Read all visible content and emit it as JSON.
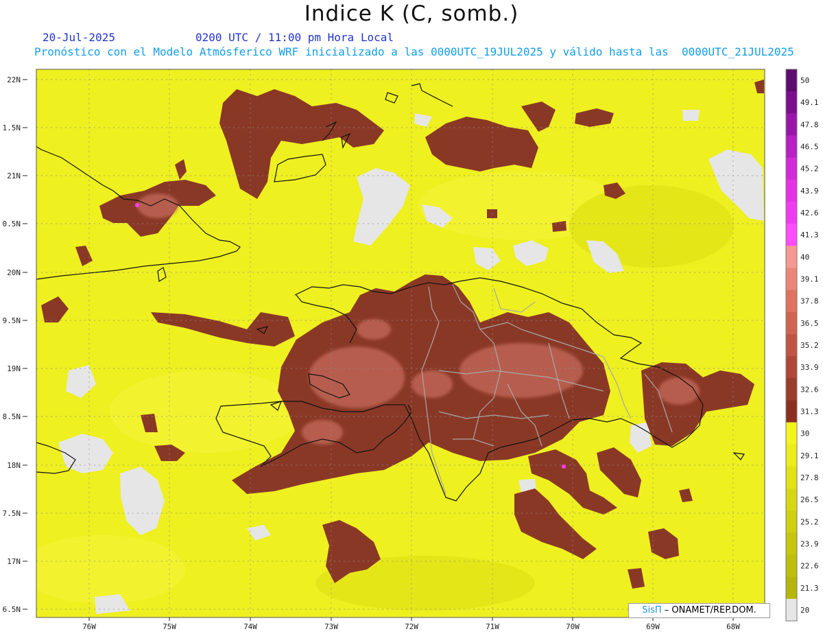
{
  "header": {
    "title": "Indice K (C, somb.)",
    "date": "20-Jul-2025",
    "time": "0200 UTC / 11:00 pm Hora Local",
    "description": "Pronóstico con el Modelo Atmósferico WRF inicializado a las 0000UTC_19JUL2025 y válido hasta las  0000UTC_21JUL2025"
  },
  "map": {
    "lat_labels": [
      "22N",
      "1.5N",
      "21N",
      "0.5N",
      "20N",
      "9.5N",
      "19N",
      "8.5N",
      "18N",
      "7.5N",
      "17N",
      "6.5N"
    ],
    "lon_labels": [
      "76W",
      "75W",
      "74W",
      "73W",
      "72W",
      "71W",
      "70W",
      "69W",
      "68W"
    ],
    "lat_range": [
      16.5,
      22
    ],
    "lon_range": [
      -76.6,
      -67.6
    ],
    "colors": {
      "background_field": "#eef020",
      "high_index": "#8a3826",
      "no_data": "#e6e6e6",
      "coastline": "#111111",
      "borders": "#a0a0a0"
    }
  },
  "colorbar": {
    "labels": [
      "50",
      "49.1",
      "47.8",
      "46.5",
      "45.2",
      "43.9",
      "42.6",
      "41.3",
      "40",
      "39.1",
      "37.8",
      "36.5",
      "35.2",
      "33.9",
      "32.6",
      "31.3",
      "30",
      "29.1",
      "27.8",
      "26.5",
      "25.2",
      "23.9",
      "22.6",
      "21.3",
      "20"
    ],
    "colors": [
      "#5f0a6e",
      "#7d0e8c",
      "#9a16aa",
      "#b81fc6",
      "#d22ad8",
      "#e432e4",
      "#f03cf0",
      "#ff4cff",
      "#f59a92",
      "#ec8678",
      "#df735f",
      "#d16451",
      "#c25444",
      "#b04736",
      "#9c3c2b",
      "#8a3020",
      "#f4f41e",
      "#ecec18",
      "#e2e214",
      "#d8d812",
      "#cfd00f",
      "#c6c60d",
      "#bebe0b",
      "#b5b50a",
      "#e6e6e6"
    ]
  },
  "credit": {
    "sis": "SisΠ",
    "rest": " – ONAMET/REP.DOM."
  }
}
